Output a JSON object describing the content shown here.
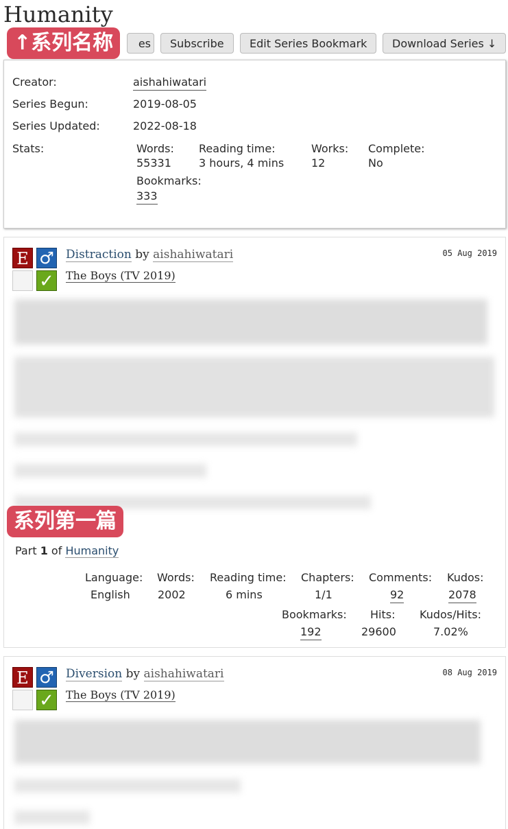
{
  "series": {
    "title": "Humanity",
    "buttons": {
      "partial": "es",
      "subscribe": "Subscribe",
      "edit_bookmark": "Edit Series Bookmark",
      "download": "Download Series ↓"
    },
    "annotation_title": "↑系列名称",
    "annotation_first": "系列第一篇",
    "meta": {
      "creator_label": "Creator:",
      "creator": "aishahiwatari",
      "begun_label": "Series Begun:",
      "begun": "2019-08-05",
      "updated_label": "Series Updated:",
      "updated": "2022-08-18",
      "stats_label": "Stats:",
      "words_label": "Words:",
      "words": "55331",
      "reading_label": "Reading time:",
      "reading": "3 hours, 4 mins",
      "works_label": "Works:",
      "works": "12",
      "complete_label": "Complete:",
      "complete": "No",
      "bookmarks_label": "Bookmarks:",
      "bookmarks": "333"
    }
  },
  "works": [
    {
      "title": "Distraction",
      "by": "by",
      "author": "aishahiwatari",
      "date": "05 Aug 2019",
      "fandom": "The Boys (TV 2019)",
      "rating_icon": "E",
      "category_icon": "♂",
      "complete_icon": "✓",
      "part_label": "Part",
      "part_num": "1",
      "part_of": "of",
      "series_link": "Humanity",
      "stats": {
        "language_label": "Language:",
        "language": "English",
        "words_label": "Words:",
        "words": "2002",
        "reading_label": "Reading time:",
        "reading": "6 mins",
        "chapters_label": "Chapters:",
        "chapters": "1/1",
        "comments_label": "Comments:",
        "comments": "92",
        "kudos_label": "Kudos:",
        "kudos": "2078",
        "bookmarks_label": "Bookmarks:",
        "bookmarks": "192",
        "hits_label": "Hits:",
        "hits": "29600",
        "kh_label": "Kudos/Hits:",
        "kh": "7.02%"
      }
    },
    {
      "title": "Diversion",
      "by": "by",
      "author": "aishahiwatari",
      "date": "08 Aug 2019",
      "fandom": "The Boys (TV 2019)",
      "rating_icon": "E",
      "category_icon": "♂",
      "complete_icon": "✓"
    }
  ]
}
